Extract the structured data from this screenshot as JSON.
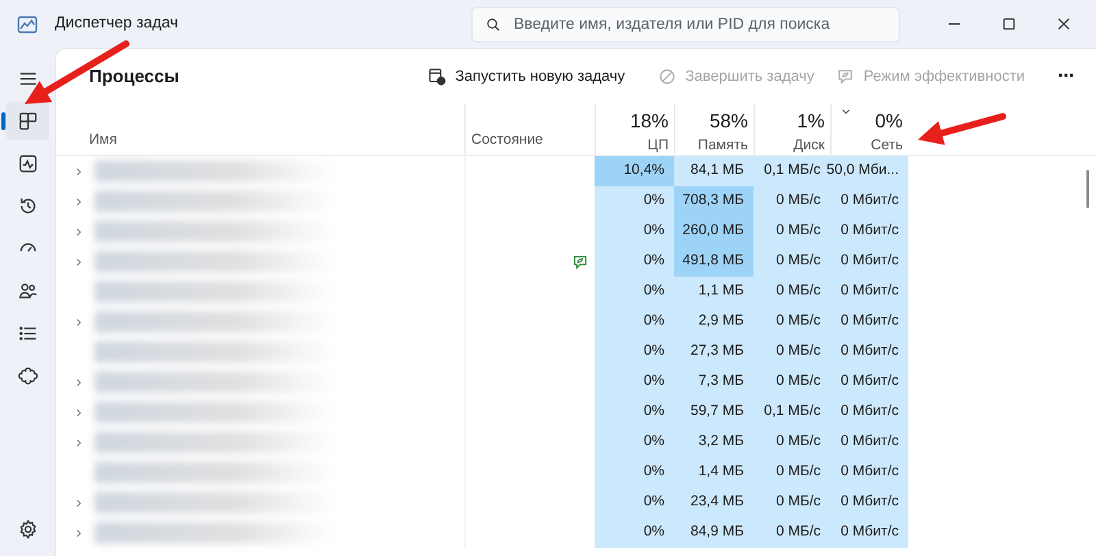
{
  "window": {
    "title": "Диспетчер задач"
  },
  "search": {
    "placeholder": "Введите имя, издателя или PID для поиска"
  },
  "sidebar": {
    "items": [
      {
        "kind": "menu",
        "selected": false
      },
      {
        "kind": "processes",
        "selected": true
      },
      {
        "kind": "performance",
        "selected": false
      },
      {
        "kind": "history",
        "selected": false
      },
      {
        "kind": "startup",
        "selected": false
      },
      {
        "kind": "users",
        "selected": false
      },
      {
        "kind": "details",
        "selected": false
      },
      {
        "kind": "services",
        "selected": false
      },
      {
        "kind": "settings",
        "selected": false
      }
    ]
  },
  "page": {
    "title": "Процессы"
  },
  "toolbar": [
    {
      "kind": "run",
      "label": "Запустить новую задачу",
      "disabled": false
    },
    {
      "kind": "end",
      "label": "Завершить задачу",
      "disabled": true
    },
    {
      "kind": "efficiency",
      "label": "Режим эффективности",
      "disabled": true
    },
    {
      "kind": "more",
      "label": "···",
      "disabled": false
    }
  ],
  "table": {
    "name_header": "Имя",
    "status_header": "Состояние",
    "columns": [
      {
        "usage": "18%",
        "label": "ЦП",
        "sorted": false
      },
      {
        "usage": "58%",
        "label": "Память",
        "sorted": false
      },
      {
        "usage": "1%",
        "label": "Диск",
        "sorted": false
      },
      {
        "usage": "0%",
        "label": "Сеть",
        "sorted": true
      }
    ],
    "rows": [
      {
        "expandable": true,
        "name_blurred": true,
        "efficiency": false,
        "cells": [
          {
            "text": "10,4%",
            "high": true
          },
          {
            "text": "84,1 МБ",
            "high": false
          },
          {
            "text": "0,1 МБ/с",
            "high": false
          },
          {
            "text": "50,0 Мби...",
            "high": false
          }
        ]
      },
      {
        "expandable": true,
        "name_blurred": true,
        "efficiency": false,
        "cells": [
          {
            "text": "0%",
            "high": false
          },
          {
            "text": "708,3 МБ",
            "high": true
          },
          {
            "text": "0 МБ/с",
            "high": false
          },
          {
            "text": "0 Мбит/с",
            "high": false
          }
        ]
      },
      {
        "expandable": true,
        "name_blurred": true,
        "efficiency": false,
        "cells": [
          {
            "text": "0%",
            "high": false
          },
          {
            "text": "260,0 МБ",
            "high": true
          },
          {
            "text": "0 МБ/с",
            "high": false
          },
          {
            "text": "0 Мбит/с",
            "high": false
          }
        ]
      },
      {
        "expandable": true,
        "name_blurred": true,
        "efficiency": true,
        "cells": [
          {
            "text": "0%",
            "high": false
          },
          {
            "text": "491,8 МБ",
            "high": true
          },
          {
            "text": "0 МБ/с",
            "high": false
          },
          {
            "text": "0 Мбит/с",
            "high": false
          }
        ]
      },
      {
        "expandable": false,
        "name_blurred": true,
        "efficiency": false,
        "cells": [
          {
            "text": "0%",
            "high": false
          },
          {
            "text": "1,1 МБ",
            "high": false
          },
          {
            "text": "0 МБ/с",
            "high": false
          },
          {
            "text": "0 Мбит/с",
            "high": false
          }
        ]
      },
      {
        "expandable": true,
        "name_blurred": true,
        "efficiency": false,
        "cells": [
          {
            "text": "0%",
            "high": false
          },
          {
            "text": "2,9 МБ",
            "high": false
          },
          {
            "text": "0 МБ/с",
            "high": false
          },
          {
            "text": "0 Мбит/с",
            "high": false
          }
        ]
      },
      {
        "expandable": false,
        "name_blurred": true,
        "efficiency": false,
        "cells": [
          {
            "text": "0%",
            "high": false
          },
          {
            "text": "27,3 МБ",
            "high": false
          },
          {
            "text": "0 МБ/с",
            "high": false
          },
          {
            "text": "0 Мбит/с",
            "high": false
          }
        ]
      },
      {
        "expandable": true,
        "name_blurred": true,
        "efficiency": false,
        "cells": [
          {
            "text": "0%",
            "high": false
          },
          {
            "text": "7,3 МБ",
            "high": false
          },
          {
            "text": "0 МБ/с",
            "high": false
          },
          {
            "text": "0 Мбит/с",
            "high": false
          }
        ]
      },
      {
        "expandable": true,
        "name_blurred": true,
        "efficiency": false,
        "cells": [
          {
            "text": "0%",
            "high": false
          },
          {
            "text": "59,7 МБ",
            "high": false
          },
          {
            "text": "0,1 МБ/с",
            "high": false
          },
          {
            "text": "0 Мбит/с",
            "high": false
          }
        ]
      },
      {
        "expandable": true,
        "name_blurred": true,
        "efficiency": false,
        "cells": [
          {
            "text": "0%",
            "high": false
          },
          {
            "text": "3,2 МБ",
            "high": false
          },
          {
            "text": "0 МБ/с",
            "high": false
          },
          {
            "text": "0 Мбит/с",
            "high": false
          }
        ]
      },
      {
        "expandable": false,
        "name_blurred": true,
        "efficiency": false,
        "cells": [
          {
            "text": "0%",
            "high": false
          },
          {
            "text": "1,4 МБ",
            "high": false
          },
          {
            "text": "0 МБ/с",
            "high": false
          },
          {
            "text": "0 Мбит/с",
            "high": false
          }
        ]
      },
      {
        "expandable": true,
        "name_blurred": true,
        "efficiency": false,
        "cells": [
          {
            "text": "0%",
            "high": false
          },
          {
            "text": "23,4 МБ",
            "high": false
          },
          {
            "text": "0 МБ/с",
            "high": false
          },
          {
            "text": "0 Мбит/с",
            "high": false
          }
        ]
      },
      {
        "expandable": true,
        "name_blurred": true,
        "efficiency": false,
        "cells": [
          {
            "text": "0%",
            "high": false
          },
          {
            "text": "84,9 МБ",
            "high": false
          },
          {
            "text": "0 МБ/с",
            "high": false
          },
          {
            "text": "0 Мбит/с",
            "high": false
          }
        ]
      }
    ]
  },
  "annotations": [
    {
      "kind": "arrow"
    },
    {
      "kind": "arrow"
    }
  ]
}
